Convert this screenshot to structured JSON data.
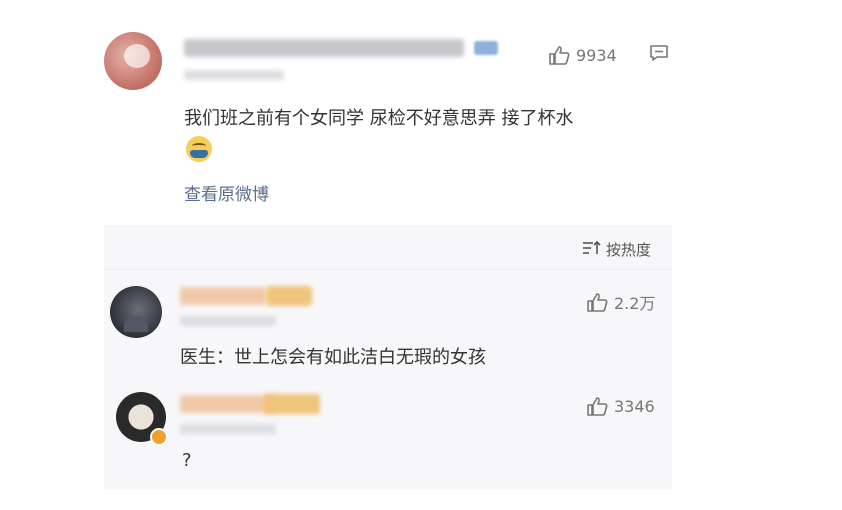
{
  "main_comment": {
    "username_blurred": true,
    "verified_badge": "verified-badge",
    "like_count": "9934",
    "text": "我们班之前有个女同学 尿检不好意思弄 接了杯水",
    "emoji": "face-emoji",
    "view_original_label": "查看原微博",
    "comment_icon": "comment-icon",
    "like_icon": "thumbs-up-icon"
  },
  "sort": {
    "label": "按热度",
    "icon": "sort-icon"
  },
  "replies": [
    {
      "username_blurred": true,
      "like_count": "2.2万",
      "text": "医生：世上怎会有如此洁白无瑕的女孩",
      "like_icon": "thumbs-up-icon"
    },
    {
      "username_blurred": true,
      "like_count": "3346",
      "text": "?",
      "like_icon": "thumbs-up-icon"
    }
  ],
  "colors": {
    "link": "#5a6e8c",
    "muted": "#777777",
    "text": "#333333",
    "card_bg": "#f7f7f9"
  }
}
